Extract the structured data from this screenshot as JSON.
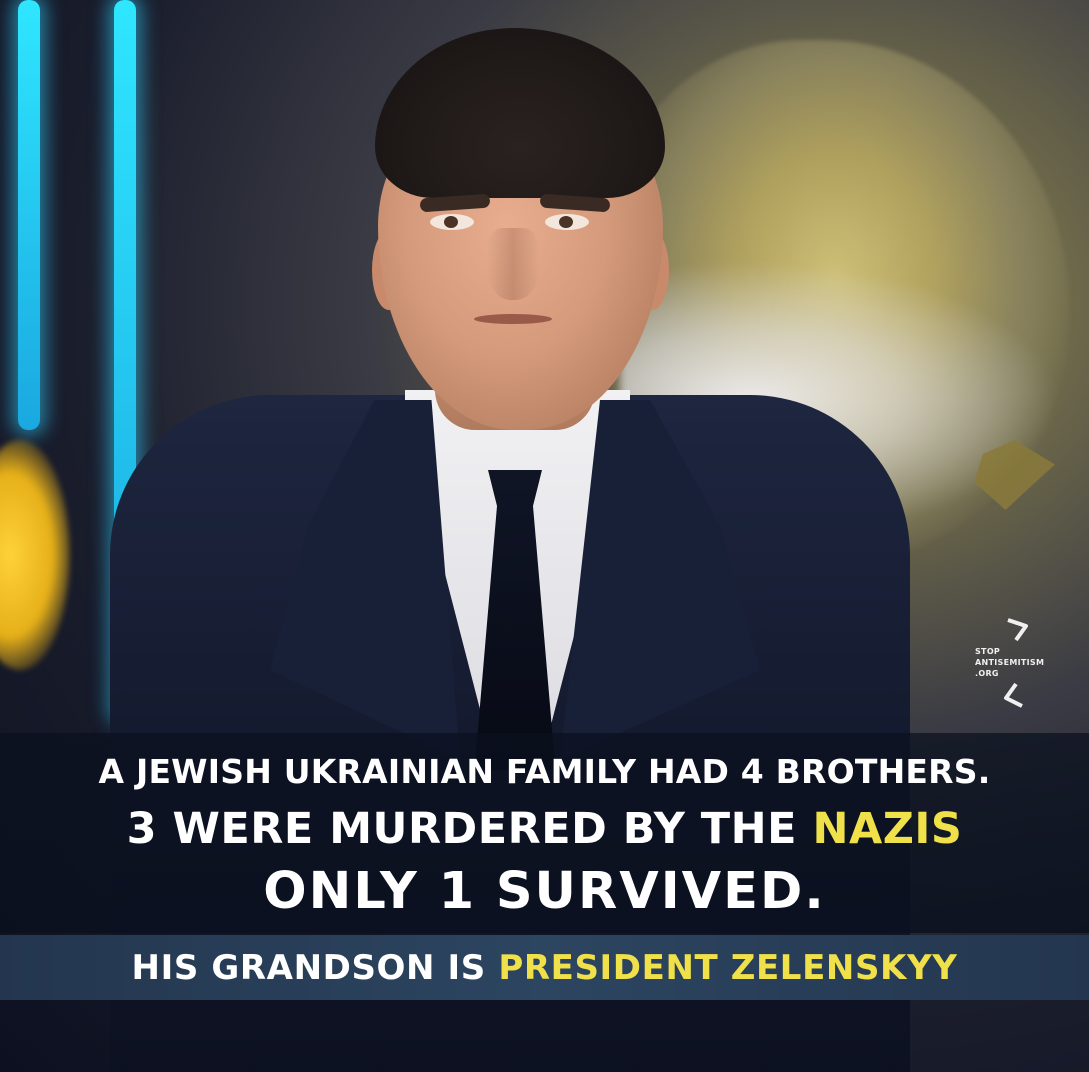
{
  "image": {
    "caption": {
      "line1": "A JEWISH UKRAINIAN FAMILY HAD 4 BROTHERS.",
      "line2_prefix": "3 WERE MURDERED BY THE ",
      "line2_highlight": "NAZIS",
      "line3": "ONLY 1 SURVIVED.",
      "line4_prefix": "HIS GRANDSON IS ",
      "line4_highlight": "PRESIDENT ZELENSKYY"
    },
    "watermark": {
      "line1": "STOP",
      "line2": "ANTISEMITISM",
      "line3": ".ORG"
    },
    "colors": {
      "highlight": "#f0e14a",
      "caption_text": "#ffffff",
      "band_blue": "#2c4560",
      "neon": "#2fe6ff"
    }
  }
}
